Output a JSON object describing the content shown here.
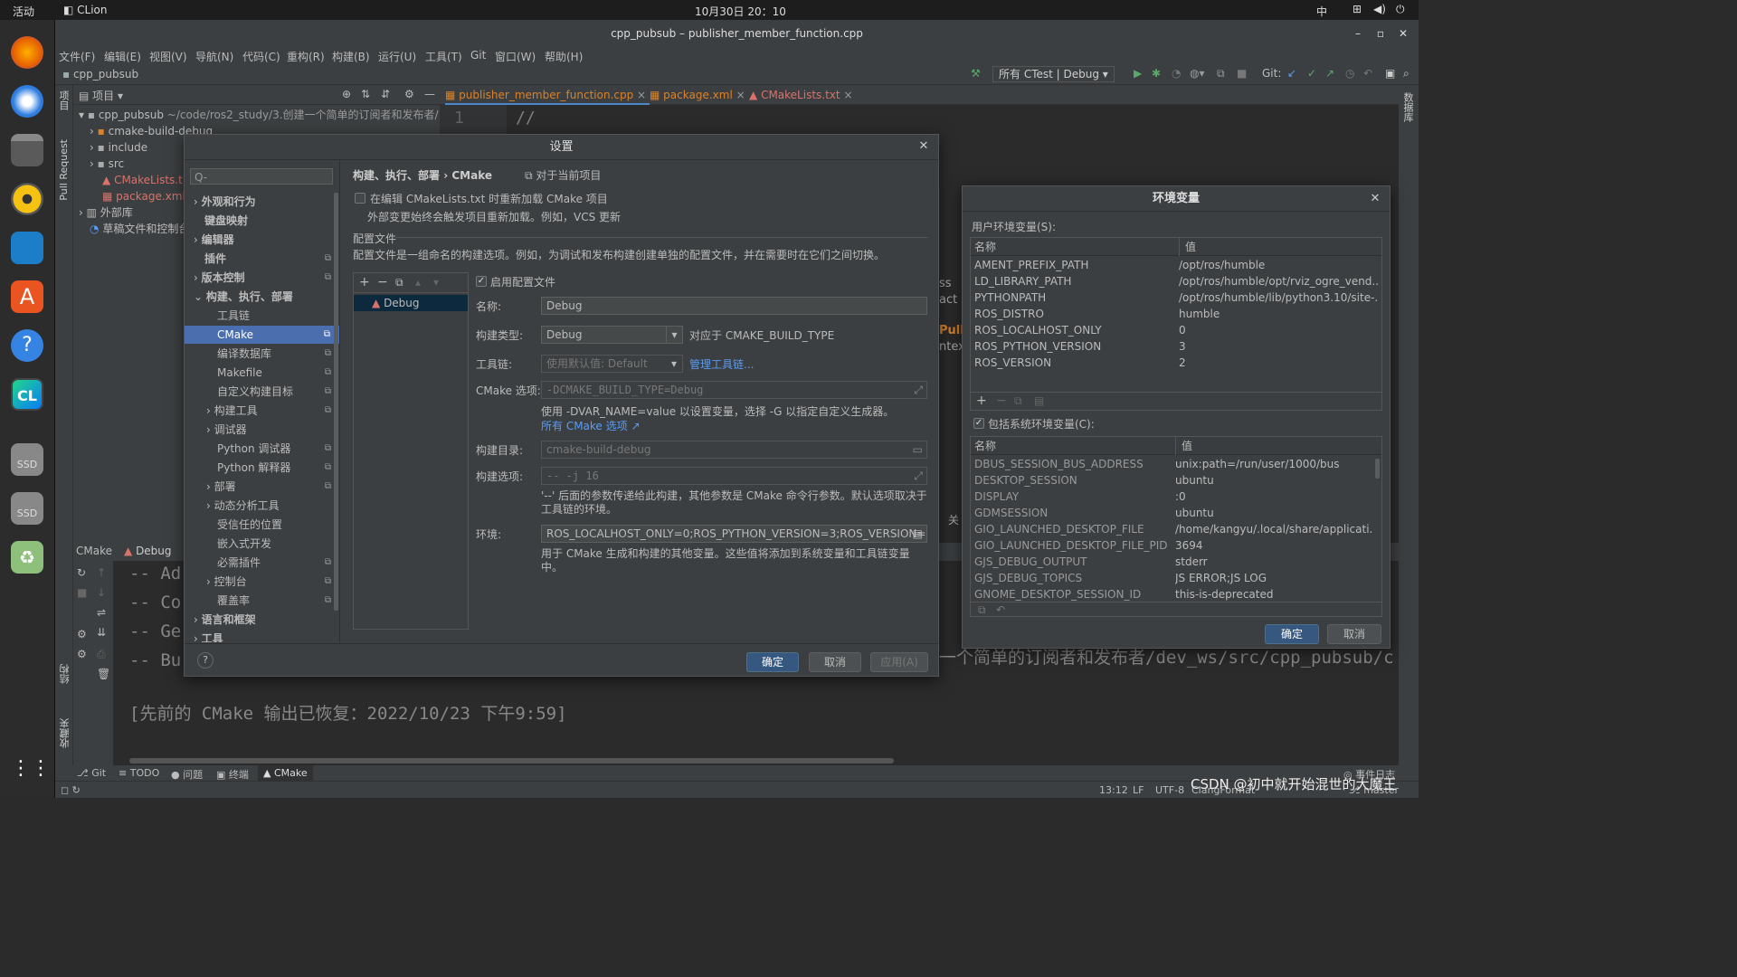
{
  "topbar": {
    "activities": "活动",
    "app": "CLion",
    "clock": "10月30日  20：10",
    "ime": "中"
  },
  "window": {
    "title": "cpp_pubsub – publisher_member_function.cpp"
  },
  "menu": [
    "文件(F)",
    "编辑(E)",
    "视图(V)",
    "导航(N)",
    "代码(C)",
    "重构(R)",
    "构建(B)",
    "运行(U)",
    "工具(T)",
    "Git",
    "窗口(W)",
    "帮助(H)"
  ],
  "navbar": {
    "project": "cpp_pubsub",
    "runconfig": "所有 CTest | Debug",
    "git": "Git:"
  },
  "projectpanel": {
    "header": "项目",
    "root": "cpp_pubsub",
    "rootpath": "~/code/ros2_study/3.创建一个简单的订阅者和发布者/",
    "items": [
      "cmake-build-debug",
      "include",
      "src",
      "CMakeLists.t",
      "package.xml",
      "外部库",
      "草稿文件和控制台"
    ]
  },
  "tabs": [
    "publisher_member_function.cpp",
    "package.xml",
    "CMakeLists.txt"
  ],
  "editor": {
    "line1": "1",
    "code1": "//"
  },
  "lefttool": {
    "project": "项目",
    "pr": "Pull Request",
    "structure": "结构",
    "bookmarks": "收藏夹"
  },
  "righttool": {
    "db": "数据库"
  },
  "bottom": {
    "tab1": "CMake",
    "tab2": "Debug",
    "lines": [
      "-- Ad",
      "-- Co",
      "-- Ge",
      "-- Bu"
    ],
    "restored": "[先前的 CMake 输出已恢复：2022/10/23 下午9:59]",
    "pathfrag": "一个简单的订阅者和发布者/dev_ws/src/cpp_pubsub/c"
  },
  "statusbar": {
    "items": [
      "Git",
      "TODO",
      "问题",
      "终端",
      "CMake"
    ],
    "pos": "13:12",
    "lf": "LF",
    "enc": "UTF-8",
    "fmt": "ClangFormat",
    "branch": "master",
    "eventlog": "事件日志",
    "watermark": "CSDN @初中就开始混世的大魔王"
  },
  "settings": {
    "title": "设置",
    "search_placeholder": "Q-",
    "breadcrumb1": "构建、执行、部署",
    "breadcrumb_sep": "›",
    "breadcrumb2": "CMake",
    "scope": "对于当前项目",
    "tree": [
      "外观和行为",
      "键盘映射",
      "编辑器",
      "插件",
      "版本控制",
      "构建、执行、部署",
      "工具链",
      "CMake",
      "编译数据库",
      "Makefile",
      "自定义构建目标",
      "构建工具",
      "调试器",
      "Python 调试器",
      "Python 解释器",
      "部署",
      "动态分析工具",
      "受信任的位置",
      "嵌入式开发",
      "必需插件",
      "控制台",
      "覆盖率",
      "语言和框架",
      "工具"
    ],
    "reload_label": "在编辑 CMakeLists.txt 时重新加载 CMake 项目",
    "reload_hint": "外部变更始终会触发项目重新加载。例如，VCS 更新",
    "profiles_title": "配置文件",
    "profiles_desc": "配置文件是一组命名的构建选项。例如，为调试和发布构建创建单独的配置文件，并在需要时在它们之间切换。",
    "profile_item": "Debug",
    "enable_profile": "启用配置文件",
    "name_label": "名称:",
    "name_value": "Debug",
    "buildtype_label": "构建类型:",
    "buildtype_value": "Debug",
    "buildtype_hint": "对应于 CMAKE_BUILD_TYPE",
    "toolchain_label": "工具链:",
    "toolchain_value": "使用默认值: Default",
    "toolchain_link": "管理工具链...",
    "cmakeopt_label": "CMake 选项:",
    "cmakeopt_value": "-DCMAKE_BUILD_TYPE=Debug",
    "cmakeopt_hint": "使用 -DVAR_NAME=value 以设置变量，选择 -G 以指定自定义生成器。",
    "cmakeopt_link": "所有 CMake 选项",
    "builddir_label": "构建目录:",
    "builddir_value": "cmake-build-debug",
    "buildopt_label": "构建选项:",
    "buildopt_value": "-- -j 16",
    "buildopt_hint": "'--' 后面的参数传递给此构建，其他参数是 CMake 命令行参数。默认选项取决于工具链的环境。",
    "env_label": "环境:",
    "env_value": "ROS_LOCALHOST_ONLY=0;ROS_PYTHON_VERSION=3;ROS_VERSION=2",
    "env_hint": "用于 CMake 生成和构建的其他变量。这些值将添加到系统变量和工具链变量中。",
    "ok": "确定",
    "cancel": "取消",
    "apply": "应用(A)",
    "help": "?"
  },
  "envdialog": {
    "title": "环境变量",
    "user_label": "用户环境变量(S):",
    "col_name": "名称",
    "col_value": "值",
    "user_vars": [
      {
        "name": "AMENT_PREFIX_PATH",
        "value": "/opt/ros/humble"
      },
      {
        "name": "LD_LIBRARY_PATH",
        "value": "/opt/ros/humble/opt/rviz_ogre_vend..."
      },
      {
        "name": "PYTHONPATH",
        "value": "/opt/ros/humble/lib/python3.10/site-..."
      },
      {
        "name": "ROS_DISTRO",
        "value": "humble"
      },
      {
        "name": "ROS_LOCALHOST_ONLY",
        "value": "0"
      },
      {
        "name": "ROS_PYTHON_VERSION",
        "value": "3"
      },
      {
        "name": "ROS_VERSION",
        "value": "2"
      }
    ],
    "include_system": "包括系统环境变量(C):",
    "sys_vars": [
      {
        "name": "DBUS_SESSION_BUS_ADDRESS",
        "value": "unix:path=/run/user/1000/bus"
      },
      {
        "name": "DESKTOP_SESSION",
        "value": "ubuntu"
      },
      {
        "name": "DISPLAY",
        "value": ":0"
      },
      {
        "name": "GDMSESSION",
        "value": "ubuntu"
      },
      {
        "name": "GIO_LAUNCHED_DESKTOP_FILE",
        "value": "/home/kangyu/.local/share/applicati..."
      },
      {
        "name": "GIO_LAUNCHED_DESKTOP_FILE_PID",
        "value": "3694"
      },
      {
        "name": "GJS_DEBUG_OUTPUT",
        "value": "stderr"
      },
      {
        "name": "GJS_DEBUG_TOPICS",
        "value": "JS ERROR;JS LOG"
      },
      {
        "name": "GNOME_DESKTOP_SESSION_ID",
        "value": "this-is-deprecated"
      }
    ],
    "ok": "确定",
    "cancel": "取消"
  },
  "behind": {
    "frag1": "ss",
    "frag2": "act i",
    "frag3": "Pull",
    "frag4": "ntex",
    "frag5": "关"
  }
}
